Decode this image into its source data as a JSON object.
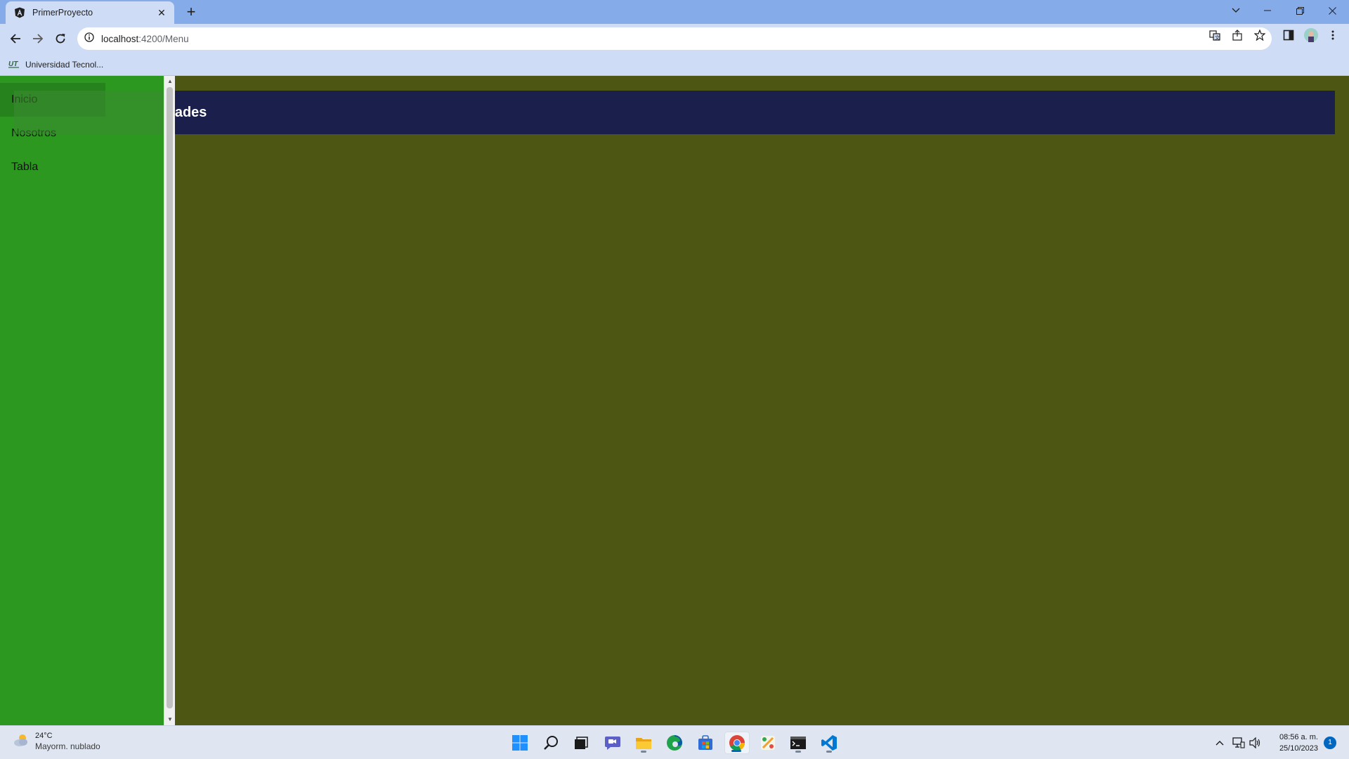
{
  "browser": {
    "tab_title": "PrimerProyecto",
    "tab_close": "✕",
    "new_tab": "+",
    "url_host": "localhost",
    "url_rest": ":4200/Menu",
    "bookmark_label": "Universidad Tecnol..."
  },
  "app": {
    "title": "Menú De Actividades",
    "sidenav_items": [
      {
        "label": "Inicio"
      },
      {
        "label": "Nosotros"
      },
      {
        "label": "Tabla"
      }
    ],
    "colors": {
      "page_background": "#4d5612",
      "toolbar_background": "#1a1f4b",
      "sidenav_background": "#2c9820"
    }
  },
  "taskbar": {
    "weather_temp": "24°C",
    "weather_condition": "Mayorm. nublado",
    "time": "08:56 a. m.",
    "date": "25/10/2023",
    "notification_count": "1",
    "apps": [
      "windows-start-icon",
      "search-icon",
      "task-view-icon",
      "teams-chat-icon",
      "file-explorer-icon",
      "edge-icon",
      "store-icon",
      "chrome-icon",
      "paint-icon",
      "terminal-icon",
      "vscode-icon"
    ]
  }
}
